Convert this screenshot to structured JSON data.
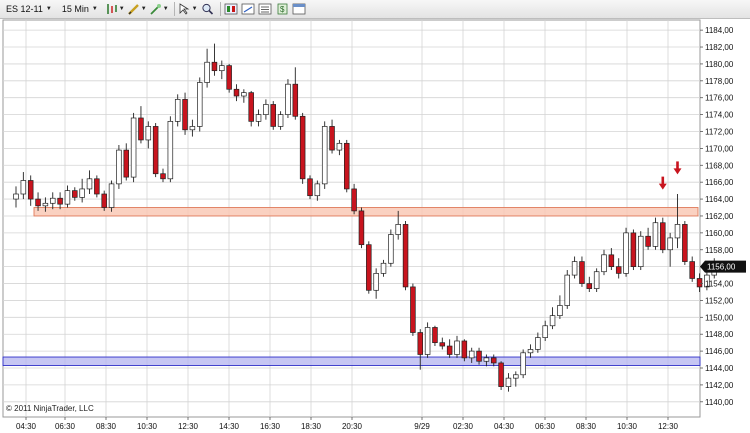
{
  "toolbar": {
    "instrument": "ES 12-11",
    "interval": "15 Min"
  },
  "copyright": "© 2011 NinjaTrader, LLC",
  "colors": {
    "up_fill": "#ffffff",
    "down_fill": "#c8141e",
    "candle_outline": "#222222",
    "grid": "#d4d4d4",
    "resistance_fill": "#f9c9b6",
    "resistance_edge": "#e07a5a",
    "support_fill": "#b8b8f0",
    "support_edge": "#2f2fc8",
    "arrow": "#c8141e"
  },
  "chart_data": {
    "type": "candlestick",
    "instrument": "ES 12-11",
    "interval": "15 Min",
    "ylim": [
      1138.2,
      1185.2
    ],
    "y_ticks": [
      "1140,00",
      "1142,00",
      "1144,00",
      "1146,00",
      "1148,00",
      "1150,00",
      "1152,00",
      "1154,00",
      "1156,00",
      "1158,00",
      "1160,00",
      "1162,00",
      "1164,00",
      "1166,00",
      "1168,00",
      "1170,00",
      "1172,00",
      "1174,00",
      "1176,00",
      "1178,00",
      "1180,00",
      "1182,00",
      "1184,00"
    ],
    "x_tick_labels": [
      "04:30",
      "06:30",
      "08:30",
      "10:30",
      "12:30",
      "14:30",
      "16:30",
      "18:30",
      "20:30",
      "9/29",
      "02:30",
      "04:30",
      "06:30",
      "08:30",
      "10:30",
      "12:30"
    ],
    "last_price": "1156,00",
    "zones": [
      {
        "from": 1162.0,
        "to": 1163.0,
        "style": "resistance"
      },
      {
        "from": 1144.3,
        "to": 1145.3,
        "style": "support"
      }
    ],
    "down_arrows": [
      {
        "bar": 88,
        "y": 1165.0
      },
      {
        "bar": 90,
        "y": 1166.8
      }
    ],
    "ohlc": [
      [
        1164.0,
        1165.5,
        1163.0,
        1164.6
      ],
      [
        1164.6,
        1167.2,
        1164.0,
        1166.2
      ],
      [
        1166.2,
        1166.8,
        1163.2,
        1164.0
      ],
      [
        1164.0,
        1164.8,
        1162.6,
        1163.2
      ],
      [
        1163.2,
        1164.2,
        1162.5,
        1163.5
      ],
      [
        1163.5,
        1164.8,
        1162.8,
        1164.1
      ],
      [
        1164.1,
        1164.8,
        1162.8,
        1163.4
      ],
      [
        1163.4,
        1165.6,
        1163.0,
        1165.0
      ],
      [
        1165.0,
        1165.4,
        1163.8,
        1164.2
      ],
      [
        1164.2,
        1166.4,
        1163.6,
        1165.2
      ],
      [
        1165.2,
        1167.4,
        1164.6,
        1166.4
      ],
      [
        1166.4,
        1166.8,
        1164.2,
        1164.6
      ],
      [
        1164.6,
        1165.0,
        1162.6,
        1163.0
      ],
      [
        1163.0,
        1166.2,
        1162.5,
        1165.8
      ],
      [
        1165.8,
        1170.4,
        1165.2,
        1169.8
      ],
      [
        1169.8,
        1170.6,
        1166.2,
        1166.6
      ],
      [
        1166.6,
        1174.2,
        1166.0,
        1173.6
      ],
      [
        1173.6,
        1175.0,
        1170.6,
        1171.0
      ],
      [
        1171.0,
        1173.2,
        1170.0,
        1172.6
      ],
      [
        1172.6,
        1173.0,
        1166.6,
        1167.0
      ],
      [
        1167.0,
        1167.6,
        1166.0,
        1166.4
      ],
      [
        1166.4,
        1173.8,
        1166.0,
        1173.2
      ],
      [
        1173.2,
        1176.4,
        1172.6,
        1175.8
      ],
      [
        1175.8,
        1176.6,
        1171.6,
        1172.2
      ],
      [
        1172.2,
        1173.4,
        1171.4,
        1172.6
      ],
      [
        1172.6,
        1178.4,
        1172.0,
        1177.8
      ],
      [
        1177.8,
        1181.8,
        1177.2,
        1180.2
      ],
      [
        1180.2,
        1182.4,
        1178.6,
        1179.2
      ],
      [
        1179.2,
        1180.4,
        1178.2,
        1179.8
      ],
      [
        1179.8,
        1180.0,
        1176.6,
        1177.0
      ],
      [
        1177.0,
        1177.6,
        1175.6,
        1176.2
      ],
      [
        1176.2,
        1177.0,
        1175.4,
        1176.6
      ],
      [
        1176.6,
        1176.8,
        1172.6,
        1173.2
      ],
      [
        1173.2,
        1174.6,
        1172.6,
        1174.0
      ],
      [
        1174.0,
        1175.8,
        1173.4,
        1175.2
      ],
      [
        1175.2,
        1175.6,
        1172.2,
        1172.6
      ],
      [
        1172.6,
        1174.4,
        1172.2,
        1174.0
      ],
      [
        1174.0,
        1178.2,
        1173.6,
        1177.6
      ],
      [
        1177.6,
        1179.6,
        1173.4,
        1173.8
      ],
      [
        1173.8,
        1174.2,
        1165.8,
        1166.4
      ],
      [
        1166.4,
        1166.8,
        1164.0,
        1164.4
      ],
      [
        1164.4,
        1166.2,
        1163.8,
        1165.8
      ],
      [
        1165.8,
        1173.2,
        1165.2,
        1172.6
      ],
      [
        1172.6,
        1173.4,
        1169.4,
        1169.8
      ],
      [
        1169.8,
        1171.0,
        1169.2,
        1170.6
      ],
      [
        1170.6,
        1171.0,
        1164.8,
        1165.2
      ],
      [
        1165.2,
        1165.8,
        1162.2,
        1162.6
      ],
      [
        1162.6,
        1163.0,
        1158.2,
        1158.6
      ],
      [
        1158.6,
        1159.0,
        1152.8,
        1153.2
      ],
      [
        1153.2,
        1155.8,
        1152.2,
        1155.2
      ],
      [
        1155.2,
        1156.8,
        1154.8,
        1156.4
      ],
      [
        1156.4,
        1160.4,
        1156.0,
        1159.8
      ],
      [
        1159.8,
        1162.6,
        1159.2,
        1161.0
      ],
      [
        1161.0,
        1161.4,
        1153.2,
        1153.6
      ],
      [
        1153.6,
        1154.0,
        1147.8,
        1148.2
      ],
      [
        1148.2,
        1148.6,
        1143.8,
        1145.6
      ],
      [
        1145.6,
        1149.4,
        1145.2,
        1148.8
      ],
      [
        1148.8,
        1149.0,
        1146.6,
        1147.0
      ],
      [
        1147.0,
        1147.6,
        1146.2,
        1146.6
      ],
      [
        1146.6,
        1147.4,
        1145.2,
        1145.6
      ],
      [
        1145.6,
        1147.8,
        1145.2,
        1147.2
      ],
      [
        1147.2,
        1147.4,
        1144.8,
        1145.2
      ],
      [
        1145.2,
        1146.4,
        1144.6,
        1146.0
      ],
      [
        1146.0,
        1146.4,
        1144.4,
        1144.8
      ],
      [
        1144.8,
        1145.6,
        1144.2,
        1145.2
      ],
      [
        1145.2,
        1145.6,
        1144.2,
        1144.6
      ],
      [
        1144.6,
        1144.8,
        1141.4,
        1141.8
      ],
      [
        1141.8,
        1143.4,
        1141.2,
        1142.8
      ],
      [
        1142.8,
        1143.6,
        1141.8,
        1143.2
      ],
      [
        1143.2,
        1146.2,
        1142.8,
        1145.8
      ],
      [
        1145.8,
        1146.8,
        1145.2,
        1146.2
      ],
      [
        1146.2,
        1148.2,
        1145.8,
        1147.6
      ],
      [
        1147.6,
        1149.6,
        1147.2,
        1149.0
      ],
      [
        1149.0,
        1151.2,
        1148.6,
        1150.2
      ],
      [
        1150.2,
        1152.6,
        1149.8,
        1151.4
      ],
      [
        1151.4,
        1155.6,
        1151.0,
        1155.0
      ],
      [
        1155.0,
        1157.2,
        1154.6,
        1156.6
      ],
      [
        1156.6,
        1157.2,
        1153.6,
        1154.0
      ],
      [
        1154.0,
        1154.8,
        1153.0,
        1153.4
      ],
      [
        1153.4,
        1155.8,
        1153.0,
        1155.4
      ],
      [
        1155.4,
        1158.0,
        1155.0,
        1157.4
      ],
      [
        1157.4,
        1158.2,
        1155.6,
        1156.0
      ],
      [
        1156.0,
        1157.0,
        1154.6,
        1155.2
      ],
      [
        1155.2,
        1160.6,
        1154.8,
        1160.0
      ],
      [
        1160.0,
        1160.4,
        1155.6,
        1156.0
      ],
      [
        1156.0,
        1160.2,
        1155.6,
        1159.6
      ],
      [
        1159.6,
        1160.6,
        1158.0,
        1158.4
      ],
      [
        1158.4,
        1161.8,
        1158.0,
        1161.2
      ],
      [
        1161.2,
        1161.8,
        1157.6,
        1158.0
      ],
      [
        1158.0,
        1160.0,
        1156.0,
        1159.4
      ],
      [
        1159.4,
        1164.6,
        1158.2,
        1161.0
      ],
      [
        1161.0,
        1161.4,
        1156.2,
        1156.6
      ],
      [
        1156.6,
        1157.2,
        1154.2,
        1154.6
      ],
      [
        1154.6,
        1155.2,
        1153.0,
        1153.6
      ],
      [
        1153.6,
        1155.4,
        1153.2,
        1155.0
      ],
      [
        1155.0,
        1157.0,
        1154.6,
        1156.0
      ]
    ]
  }
}
